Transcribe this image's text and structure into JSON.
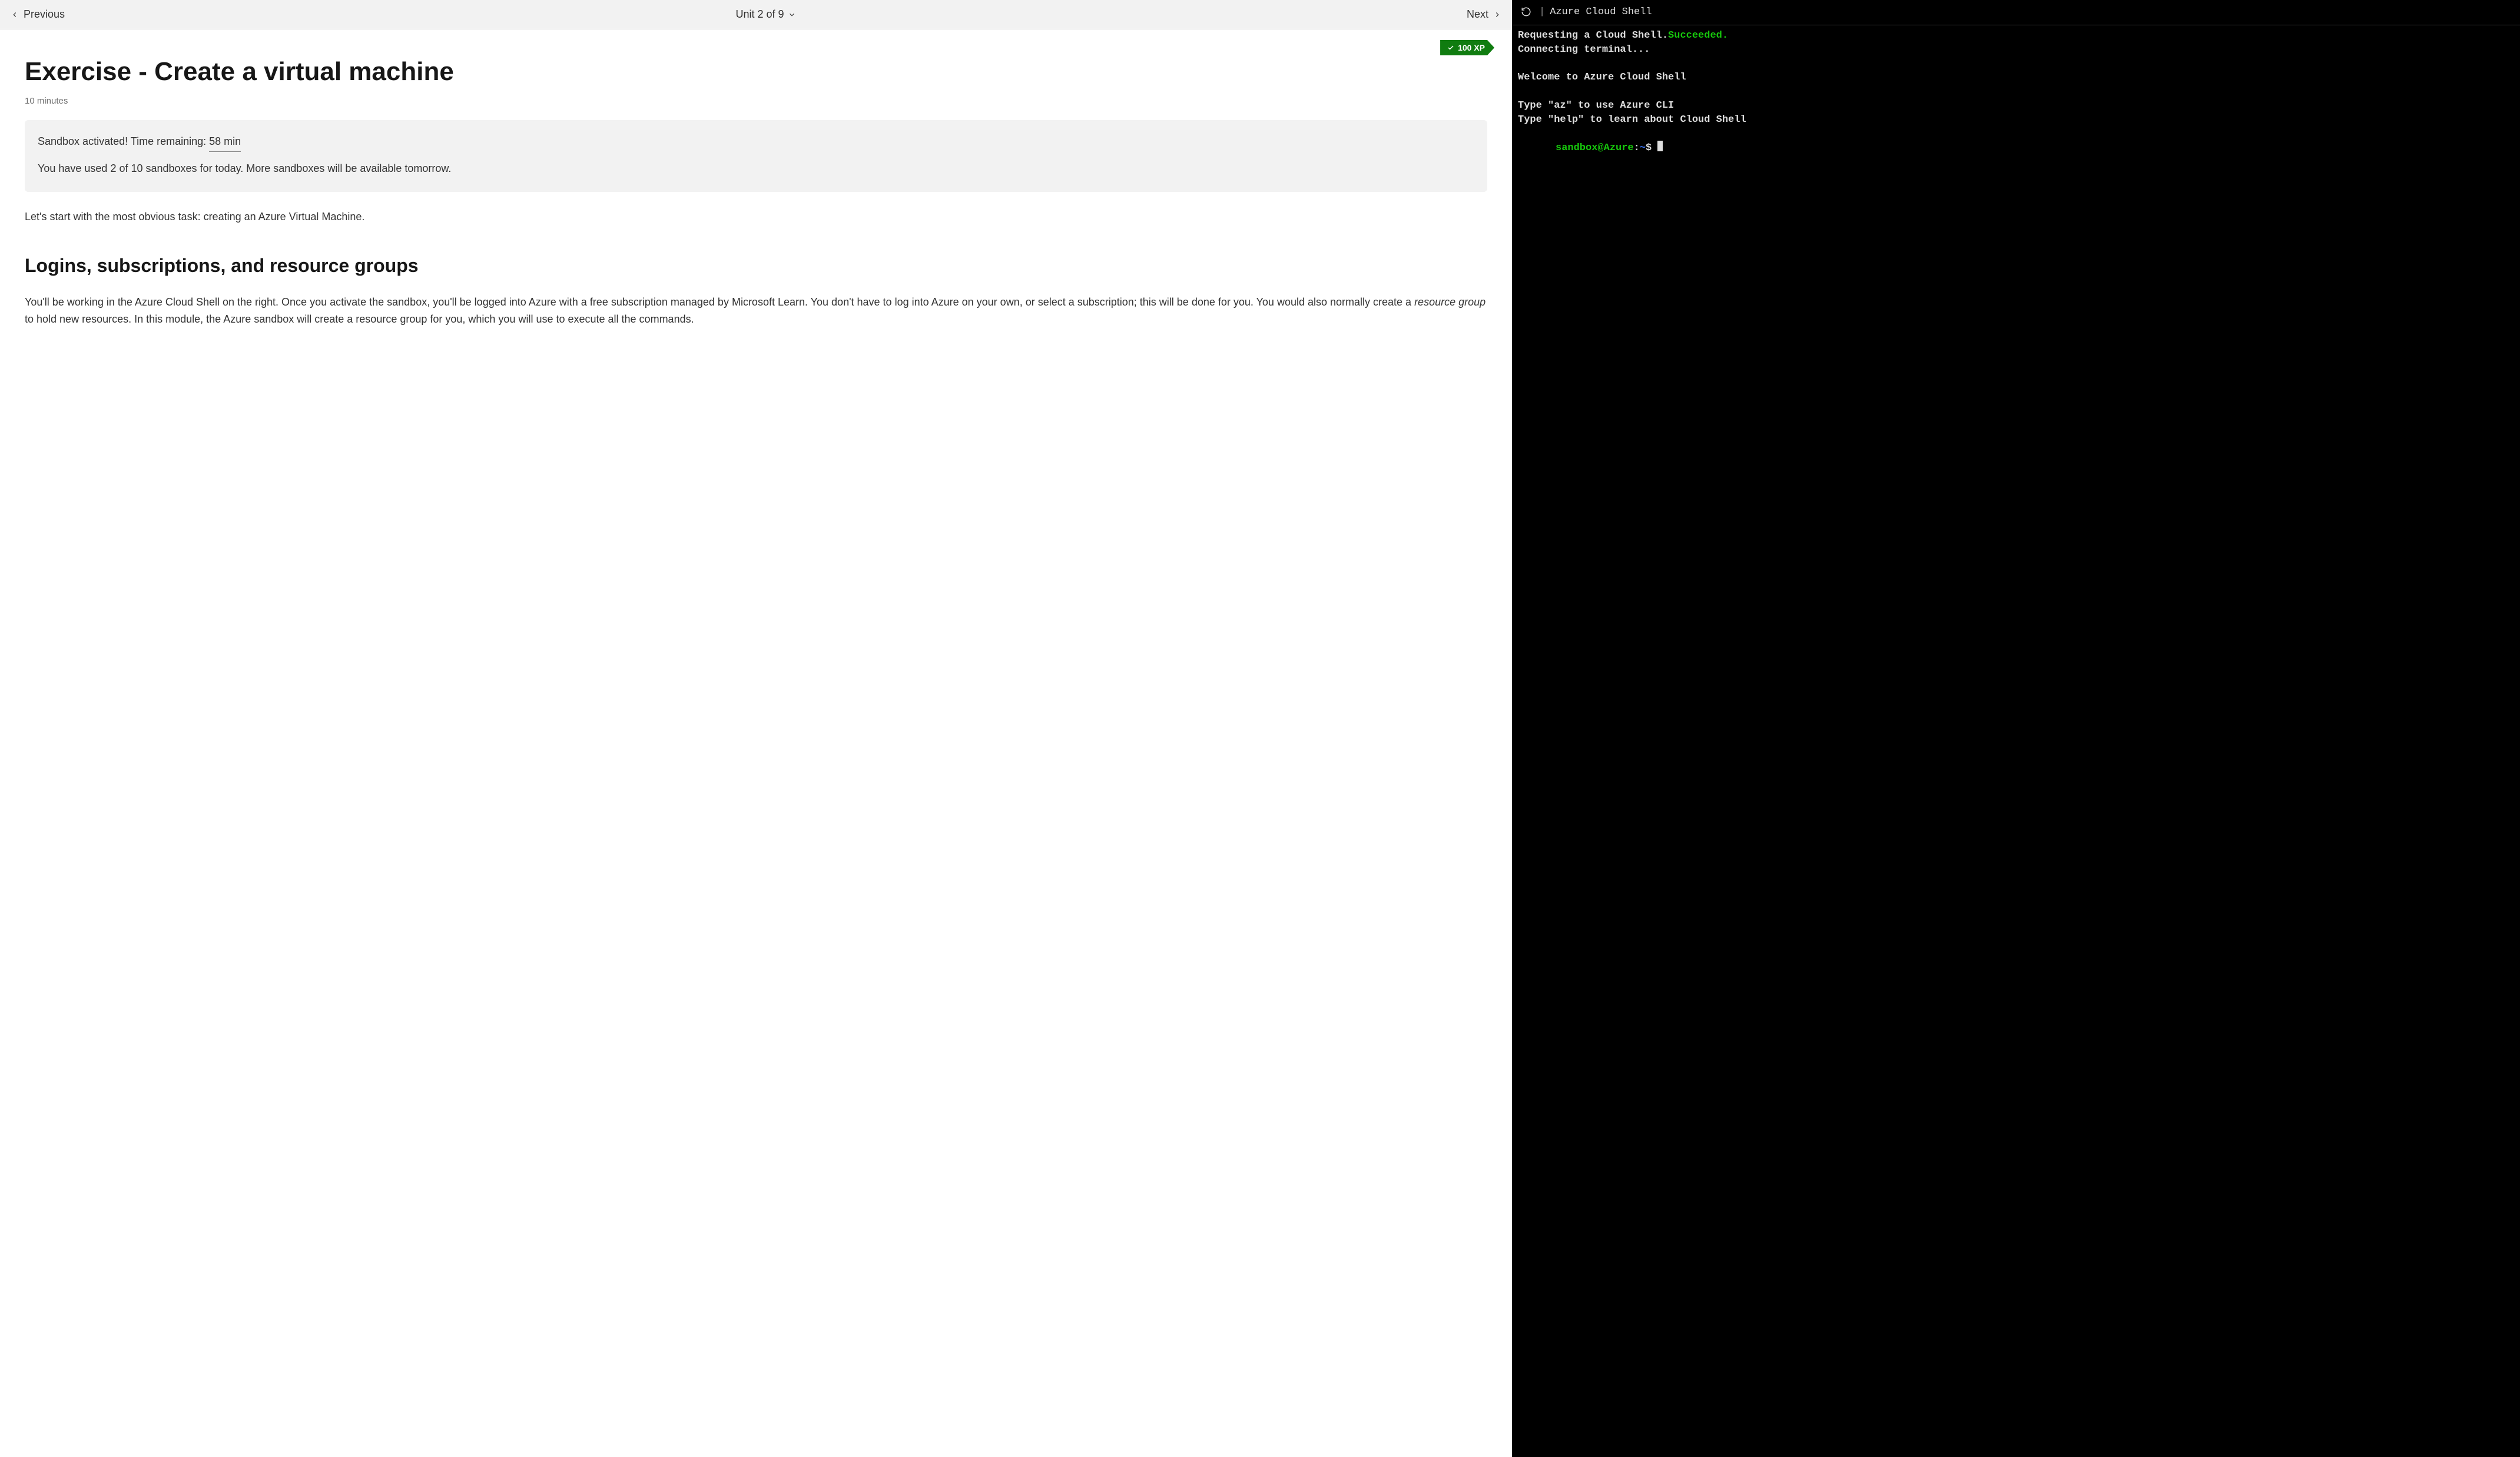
{
  "nav": {
    "prev_label": "Previous",
    "next_label": "Next",
    "unit_label": "Unit 2 of 9"
  },
  "xp": {
    "label": "100 XP"
  },
  "main": {
    "title": "Exercise - Create a virtual machine",
    "time_estimate": "10 minutes",
    "sandbox": {
      "status_prefix": "Sandbox activated! Time remaining: ",
      "time_remaining": "58 min",
      "usage_note": "You have used 2 of 10 sandboxes for today. More sandboxes will be available tomorrow."
    },
    "intro_text": "Let's start with the most obvious task: creating an Azure Virtual Machine.",
    "heading2": "Logins, subscriptions, and resource groups",
    "body2_a": "You'll be working in the Azure Cloud Shell on the right. Once you activate the sandbox, you'll be logged into Azure with a free subscription managed by Microsoft Learn. You don't have to log into Azure on your own, or select a subscription; this will be done for you. You would also normally create a ",
    "body2_em": "resource group",
    "body2_b": " to hold new resources. In this module, the Azure sandbox will create a resource group for you, which you will use to execute all the commands."
  },
  "terminal": {
    "title": "Azure Cloud Shell",
    "line1_a": "Requesting a Cloud Shell.",
    "line1_b": "Succeeded.",
    "line2": "Connecting terminal...",
    "welcome": "Welcome to Azure Cloud Shell",
    "hint1": "Type \"az\" to use Azure CLI",
    "hint2": "Type \"help\" to learn about Cloud Shell",
    "prompt_user": "sandbox",
    "prompt_at": "@",
    "prompt_host": "Azure",
    "prompt_colon": ":",
    "prompt_path": "~",
    "prompt_symbol": "$"
  }
}
